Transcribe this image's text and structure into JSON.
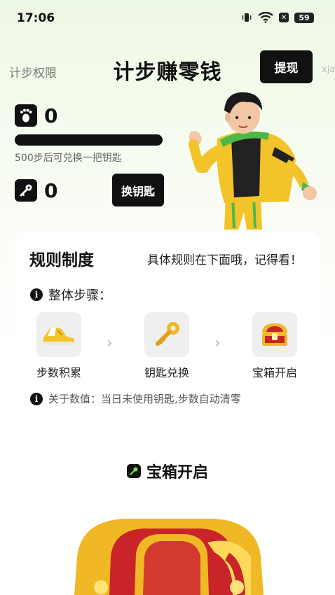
{
  "status": {
    "time": "17:06",
    "battery": "59"
  },
  "header": {
    "left_link": "计步权限",
    "title": "计步赚零钱",
    "withdraw_label": "提现",
    "right_link": "xja"
  },
  "stats": {
    "steps": "0",
    "progress": 0,
    "hint": "500步后可兑换一把钥匙",
    "keys": "0",
    "exchange_label": "换钥匙"
  },
  "rules": {
    "title": "规则制度",
    "note": "具体规则在下面哦，记得看！",
    "steps_label": "整体步骤：",
    "steps": [
      {
        "label": "步数积累",
        "icon": "sneaker-icon"
      },
      {
        "label": "钥匙兑换",
        "icon": "key-icon"
      },
      {
        "label": "宝箱开启",
        "icon": "treasure-chest-icon"
      }
    ],
    "value_note": "关于数值：当日未使用钥匙,步数自动清零"
  },
  "chest_section": {
    "title": "宝箱开启"
  },
  "colors": {
    "accent": "#111111",
    "jacket_yellow": "#f2c42a",
    "jacket_green": "#4cb84a",
    "chest_red": "#c8242a",
    "chest_gold": "#f0b824"
  }
}
